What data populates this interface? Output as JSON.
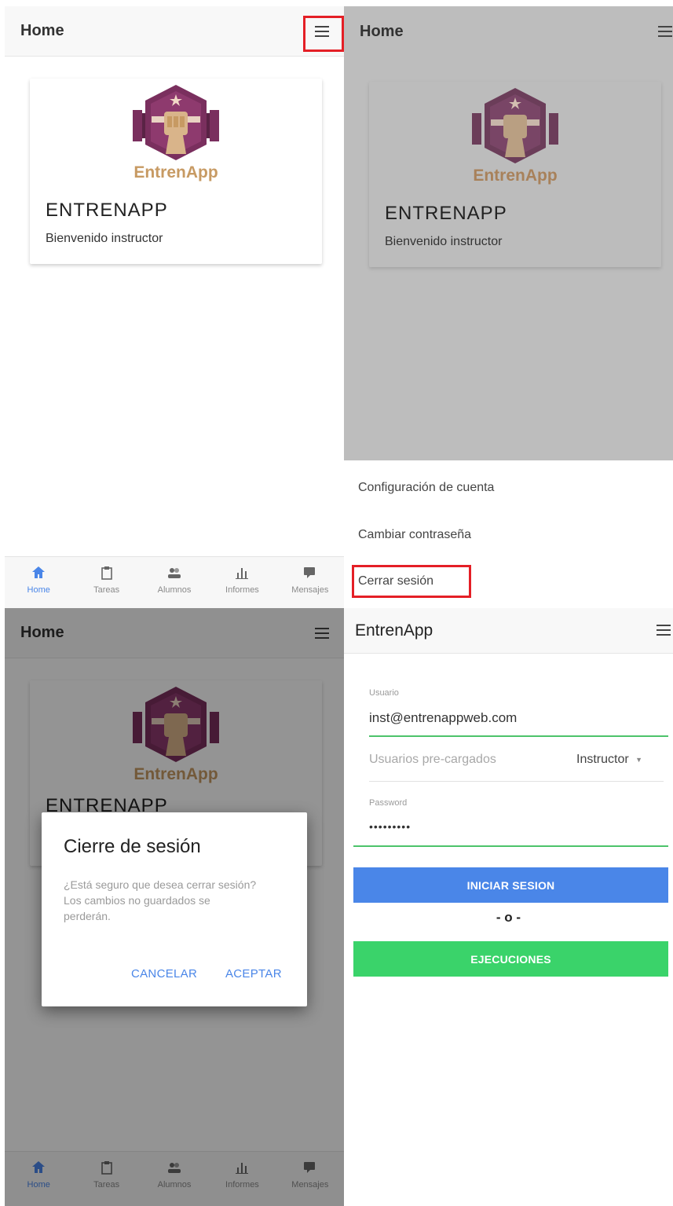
{
  "colors": {
    "primary": "#4a86e8",
    "success": "#3ad36a",
    "highlight": "#e41f26",
    "logo_purple": "#7a2f5e",
    "logo_tan": "#c79a63"
  },
  "home": {
    "app_title": "Home",
    "menu_icon": "hamburger-menu-icon",
    "logo_text": "EntrenApp",
    "card_title": "ENTRENAPP",
    "card_subtitle": "Bienvenido instructor"
  },
  "bottom_nav": [
    {
      "label": "Home",
      "icon": "home-icon",
      "active": true
    },
    {
      "label": "Tareas",
      "icon": "clipboard-icon",
      "active": false
    },
    {
      "label": "Alumnos",
      "icon": "people-icon",
      "active": false
    },
    {
      "label": "Informes",
      "icon": "chart-icon",
      "active": false
    },
    {
      "label": "Mensajes",
      "icon": "chat-icon",
      "active": false
    }
  ],
  "drawer": {
    "items": [
      {
        "label": "Configuración de cuenta"
      },
      {
        "label": "Cambiar contraseña"
      },
      {
        "label": "Cerrar sesión"
      }
    ]
  },
  "logout_dialog": {
    "title": "Cierre de sesión",
    "body": "¿Está seguro que desea cerrar sesión? Los cambios no guardados se perderán.",
    "cancel": "CANCELAR",
    "accept": "ACEPTAR",
    "background_title": "ENTRENAPP"
  },
  "login": {
    "app_title": "EntrenApp",
    "user_label": "Usuario",
    "user_value": "inst@entrenappweb.com",
    "preloaded_label": "Usuarios pre-cargados",
    "preloaded_value": "Instructor",
    "password_label": "Password",
    "password_value": "•••••••••",
    "login_button": "INICIAR SESION",
    "separator": "- o -",
    "executions_button": "EJECUCIONES"
  }
}
